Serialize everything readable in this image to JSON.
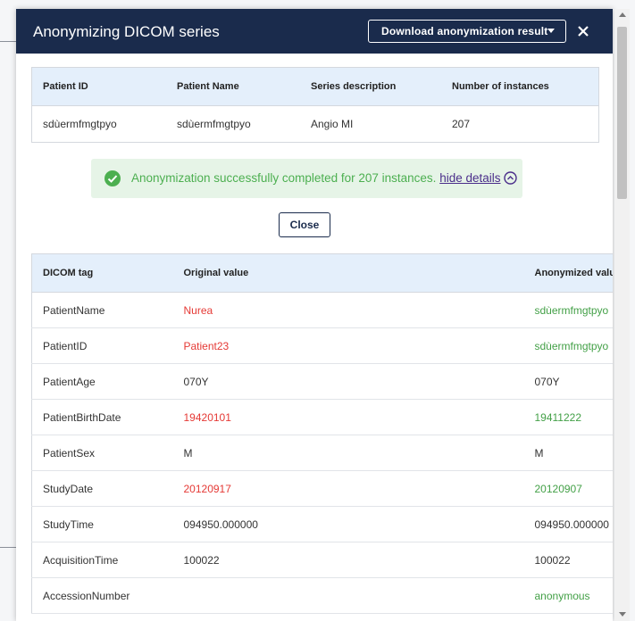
{
  "modal": {
    "title": "Anonymizing DICOM series",
    "download_label": "Download anonymization result",
    "close_label": "Close"
  },
  "summary": {
    "headers": [
      "Patient ID",
      "Patient Name",
      "Series description",
      "Number of instances"
    ],
    "row": [
      "sdùermfmgtpyo",
      "sdùermfmgtpyo",
      "Angio MI",
      "207"
    ]
  },
  "status": {
    "message": "Anonymization successfully completed for 207 instances.",
    "hide_details": "hide details"
  },
  "tags": {
    "headers": [
      "DICOM tag",
      "Original value",
      "Anonymized value"
    ],
    "rows": [
      {
        "tag": "PatientName",
        "original": "Nurea",
        "anonymized": "sdùermfmgtpyo",
        "changed": true
      },
      {
        "tag": "PatientID",
        "original": "Patient23",
        "anonymized": "sdùermfmgtpyo",
        "changed": true
      },
      {
        "tag": "PatientAge",
        "original": "070Y",
        "anonymized": "070Y",
        "changed": false
      },
      {
        "tag": "PatientBirthDate",
        "original": "19420101",
        "anonymized": "19411222",
        "changed": true
      },
      {
        "tag": "PatientSex",
        "original": "M",
        "anonymized": "M",
        "changed": false
      },
      {
        "tag": "StudyDate",
        "original": "20120917",
        "anonymized": "20120907",
        "changed": true
      },
      {
        "tag": "StudyTime",
        "original": "094950.000000",
        "anonymized": "094950.000000",
        "changed": false
      },
      {
        "tag": "AcquisitionTime",
        "original": "100022",
        "anonymized": "100022",
        "changed": false
      },
      {
        "tag": "AccessionNumber",
        "original": "",
        "anonymized": "anonymous",
        "changed": true
      }
    ]
  },
  "colors": {
    "header_bg": "#1a2b4c",
    "table_header_bg": "#e4effb",
    "original_changed": "#e53935",
    "anonymized_changed": "#43a047",
    "success_bg": "#e6f4e7",
    "success_text": "#4caf50"
  },
  "icons": {
    "close": "close-icon",
    "dropdown": "chevron-down-icon",
    "success": "check-circle-icon",
    "collapse": "chevron-up-circle-icon"
  }
}
